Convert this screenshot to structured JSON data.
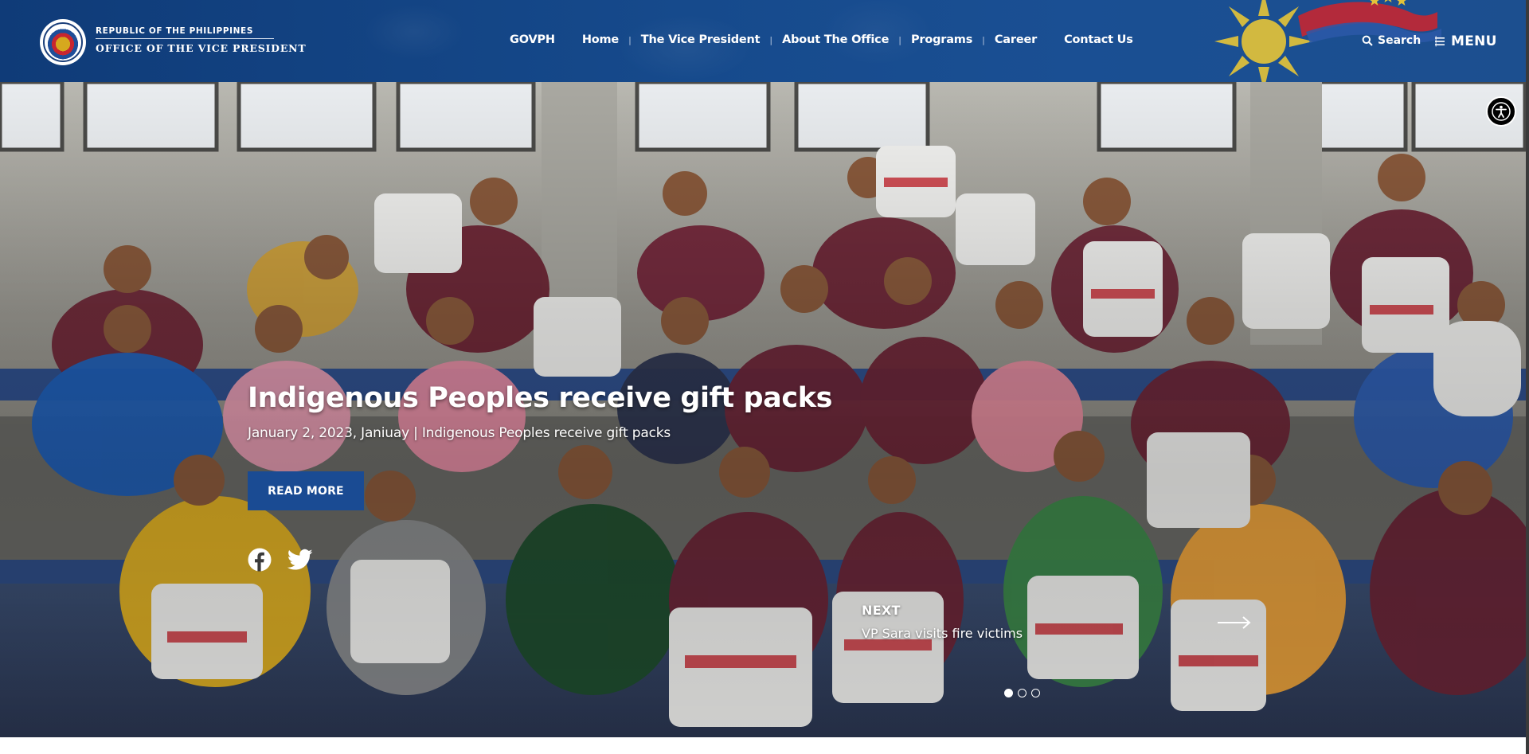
{
  "header": {
    "brand_top": "REPUBLIC OF THE PHILIPPINES",
    "brand_main": "OFFICE OF THE VICE PRESIDENT",
    "nav": [
      {
        "label": "GOVPH"
      },
      {
        "label": "Home"
      },
      {
        "label": "The Vice President"
      },
      {
        "label": "About The Office"
      },
      {
        "label": "Programs"
      },
      {
        "label": "Career"
      },
      {
        "label": "Contact Us"
      }
    ],
    "search_label": "Search",
    "menu_label": "MENU",
    "icons": {
      "seal": "ovp-seal-icon",
      "search": "search-icon",
      "menu": "hamburger-icon"
    }
  },
  "hero": {
    "slide": {
      "title": "Indigenous Peoples receive gift packs",
      "meta": "January 2, 2023, Janiuay | Indigenous Peoples receive gift packs",
      "cta_label": "READ MORE"
    },
    "next": {
      "label": "NEXT",
      "title": "VP Sara visits fire victims"
    },
    "dots": {
      "count": 3,
      "active_index": 0
    },
    "social_icons": [
      "facebook-icon",
      "twitter-icon"
    ],
    "accessibility_icon": "accessibility-icon"
  },
  "colors": {
    "header_bg": "#164a8c",
    "cta_bg": "#1a4b93",
    "sun_yellow": "#e2c33a",
    "flag_red": "#c8262f",
    "text_white": "#ffffff"
  }
}
